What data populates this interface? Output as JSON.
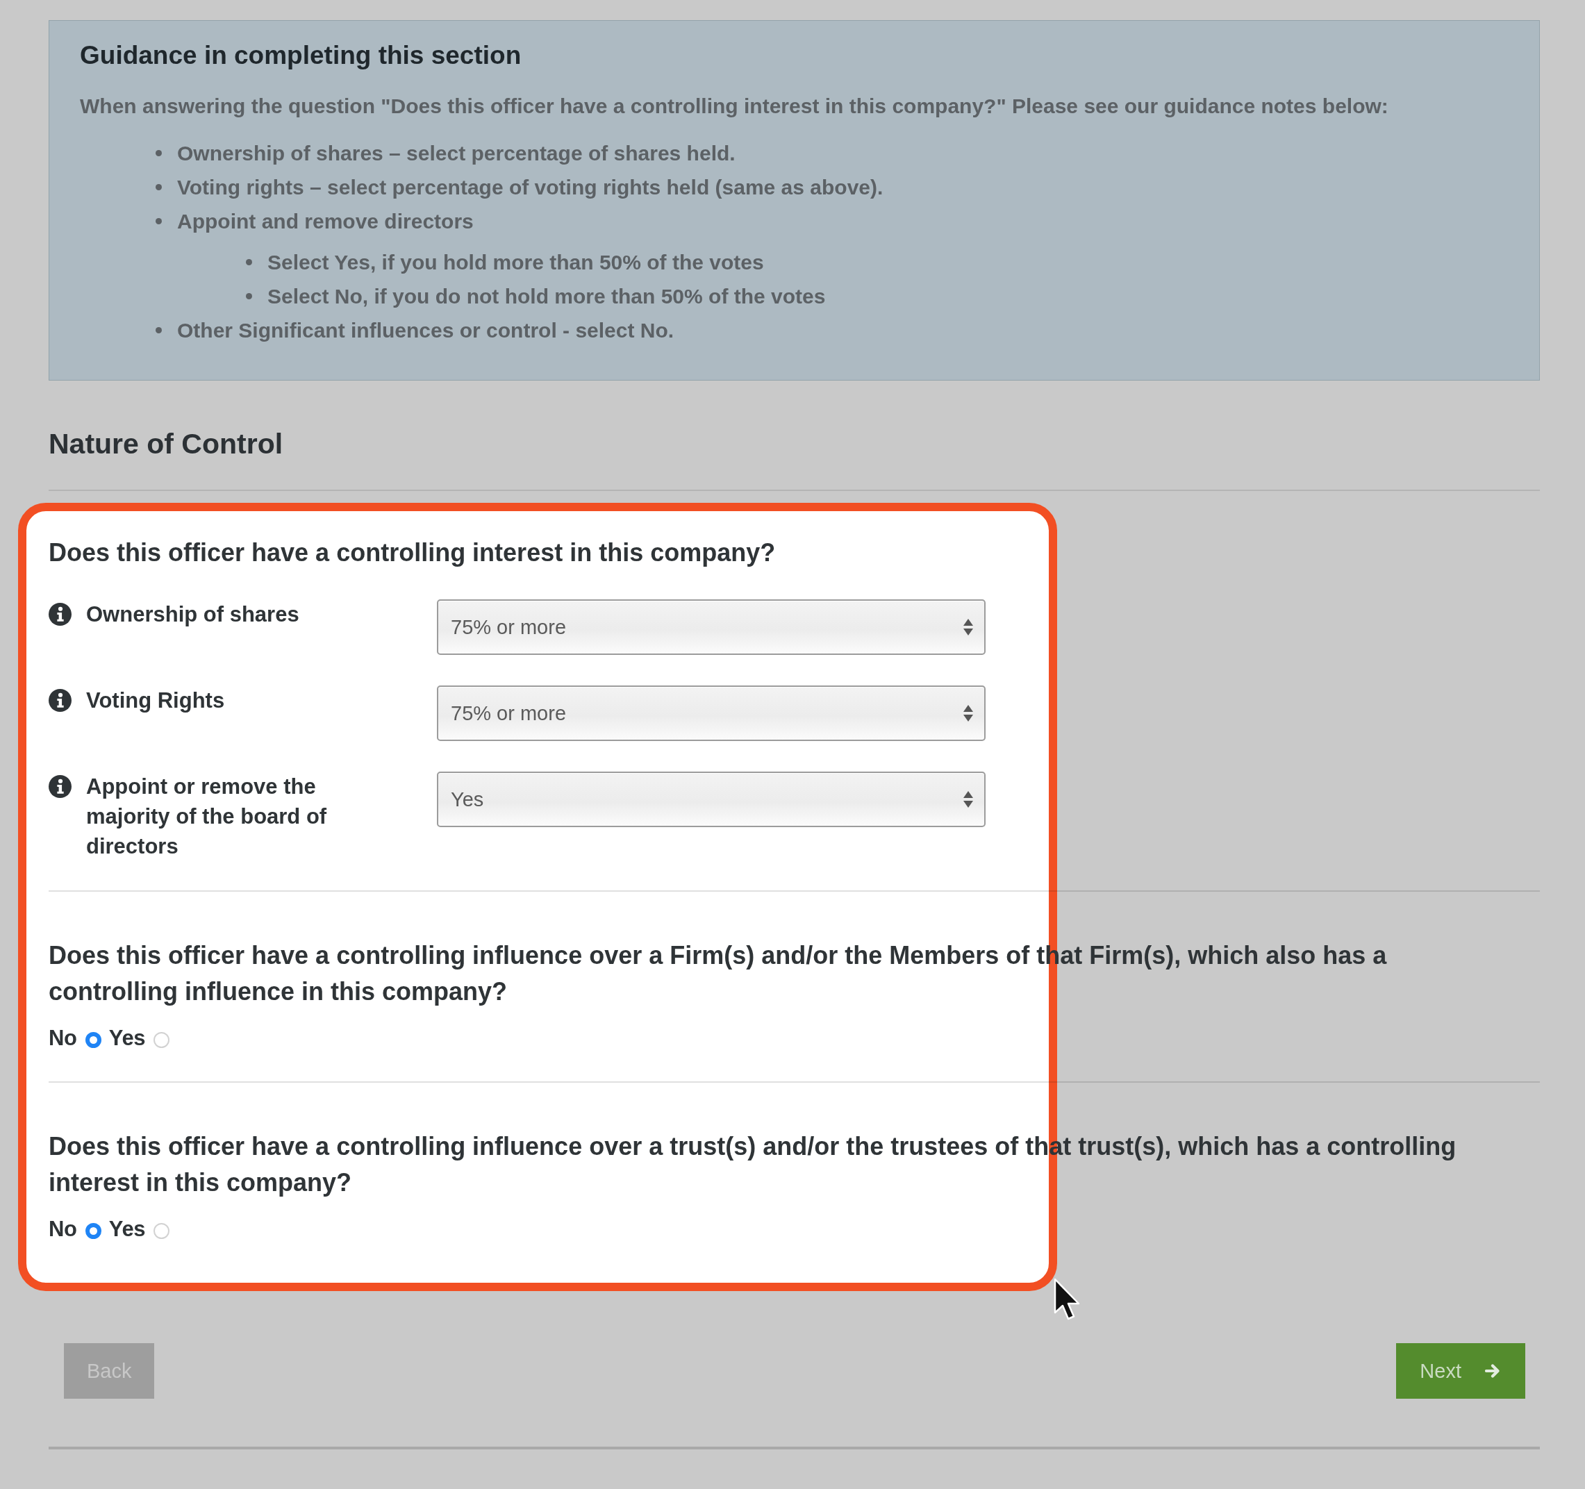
{
  "guidance": {
    "title": "Guidance in completing this section",
    "intro": "When answering the question \"Does this officer have a controlling interest in this company?\" Please see our guidance notes below:",
    "notes": [
      {
        "text": "Ownership of shares – select percentage of shares held."
      },
      {
        "text": "Voting rights – select percentage of voting rights held (same as above)."
      },
      {
        "text": "Appoint and remove directors",
        "children": [
          {
            "text": "Select Yes, if you hold more than 50% of the votes"
          },
          {
            "text": "Select No, if you do not hold more than 50% of the votes"
          }
        ]
      },
      {
        "text": "Other Significant influences or control - select No."
      }
    ]
  },
  "section": {
    "title": "Nature of Control"
  },
  "questions": [
    {
      "kind": "selects",
      "text": "Does this officer have a controlling interest in this company?",
      "fields": [
        {
          "label": "Ownership of shares",
          "value": "75% or more"
        },
        {
          "label": "Voting Rights",
          "value": "75% or more"
        },
        {
          "label": "Appoint or remove the majority of the board of directors",
          "value": "Yes"
        }
      ]
    },
    {
      "kind": "radio",
      "text": "Does this officer have a controlling influence over a Firm(s) and/or the Members of that Firm(s), which also has a controlling influence in this company?",
      "options": [
        {
          "label": "No",
          "selected": true
        },
        {
          "label": "Yes",
          "selected": false
        }
      ]
    },
    {
      "kind": "radio",
      "text": "Does this officer have a controlling influence over a trust(s) and/or the trustees of that trust(s), which has a controlling interest in this company?",
      "options": [
        {
          "label": "No",
          "selected": true
        },
        {
          "label": "Yes",
          "selected": false
        }
      ]
    }
  ],
  "buttons": [
    {
      "kind": "back",
      "label": "Back"
    },
    {
      "kind": "next",
      "label": "Next"
    }
  ]
}
